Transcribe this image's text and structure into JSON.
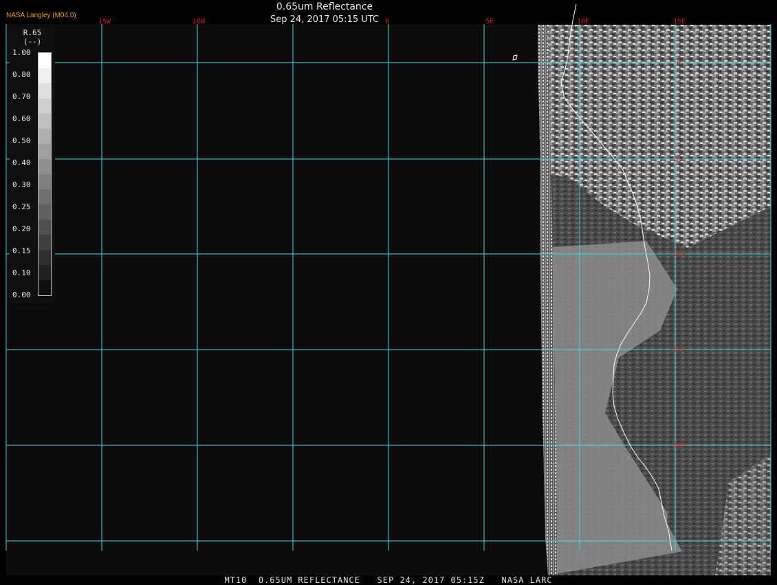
{
  "header": {
    "source": "NASA Langley (M04.0)",
    "product": "0.65um Reflectance",
    "datetime": "Sep 24, 2017 05:15 UTC"
  },
  "legend": {
    "title": "R.65",
    "units": "(--)",
    "ticks": [
      "1.00",
      "0.80",
      "0.70",
      "0.60",
      "0.50",
      "0.40",
      "0.30",
      "0.25",
      "0.20",
      "0.15",
      "0.10",
      "0.00"
    ],
    "swatches": [
      "#ffffff",
      "#f0f0f0",
      "#e0e0e0",
      "#cfcfcf",
      "#bfbfbf",
      "#afafaf",
      "#9f9f9f",
      "#8f8f8f",
      "#7f7f7f",
      "#707070",
      "#606060",
      "#505050",
      "#404040",
      "#303030",
      "#202020",
      "#101010"
    ]
  },
  "map": {
    "lon_labels": [
      "15W",
      "10W",
      "0",
      "5E",
      "10E",
      "15E"
    ],
    "lat_labels": [
      "0",
      "5S",
      "10S",
      "15S",
      "20S"
    ],
    "grid_color": "#40d8e0",
    "label_color": "#cc2020",
    "coast_color": "#ffffff",
    "background": "#0c0c0c"
  },
  "footer": "MT10  0.65UM REFLECTANCE   SEP 24, 2017 05:15Z   NASA LARC"
}
